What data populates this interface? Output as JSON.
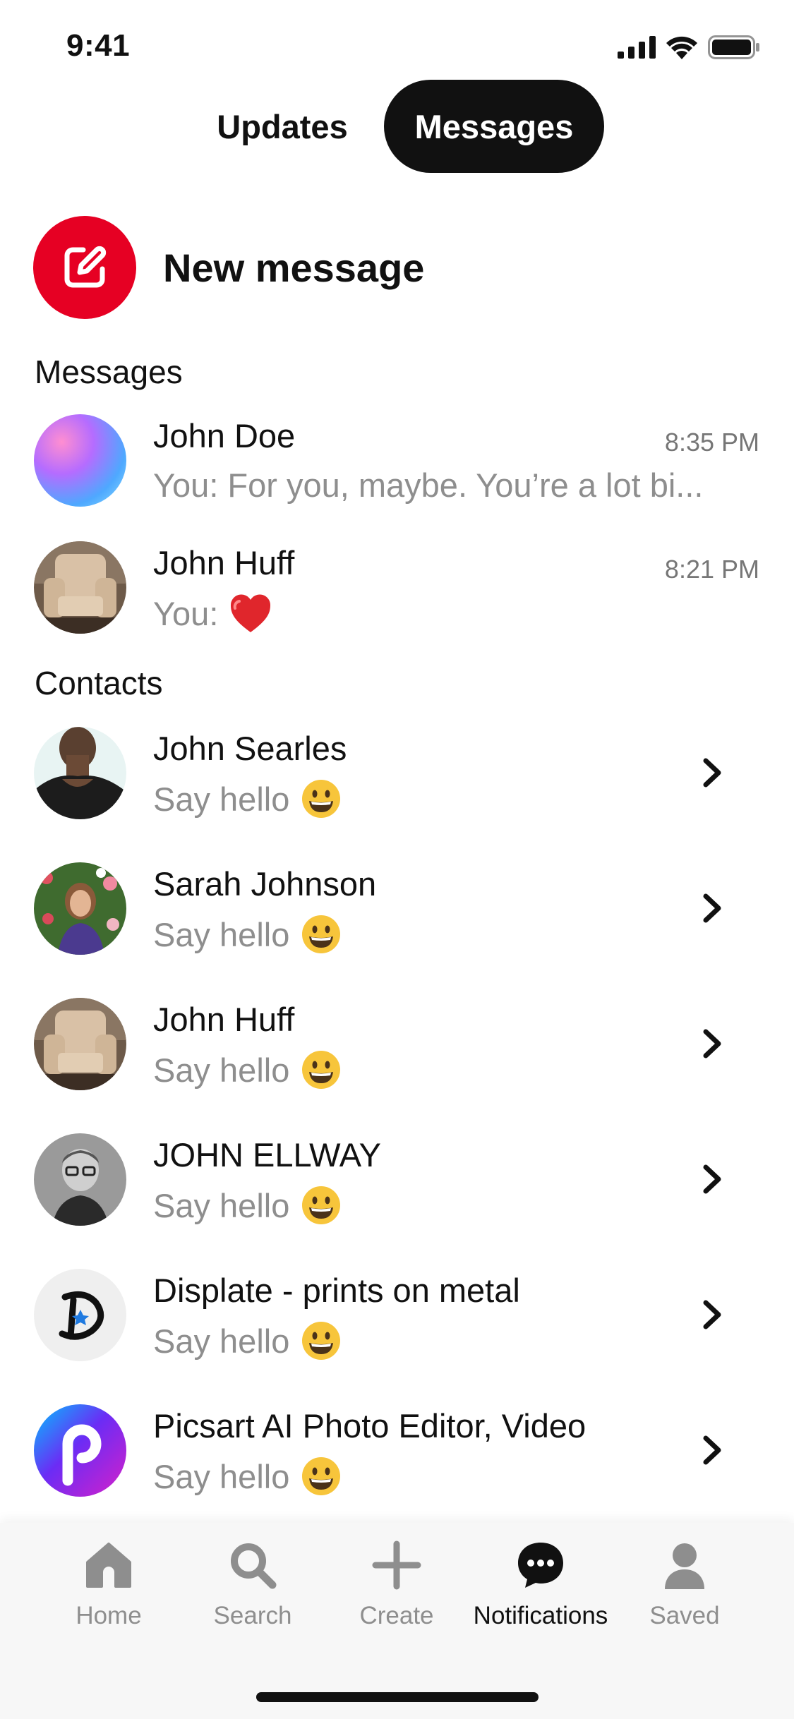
{
  "status_bar": {
    "time": "9:41"
  },
  "tabs": [
    {
      "label": "Updates",
      "active": false
    },
    {
      "label": "Messages",
      "active": true
    }
  ],
  "new_message": {
    "label": "New message",
    "accent": "#e60023"
  },
  "messages_section": {
    "heading": "Messages",
    "items": [
      {
        "name": "John Doe",
        "preview": "You: For you, maybe. You’re a lot bi...",
        "time": "8:35 PM",
        "avatar": "gradient-avatar"
      },
      {
        "name": "John Huff",
        "preview": "You:",
        "preview_emoji": "red-heart",
        "time": "8:21 PM",
        "avatar": "armchair-photo"
      }
    ]
  },
  "contacts_section": {
    "heading": "Contacts",
    "items": [
      {
        "name": "John Searles",
        "sub": "Say hello",
        "avatar": "portrait-photo"
      },
      {
        "name": "Sarah Johnson",
        "sub": "Say hello",
        "avatar": "portrait-photo"
      },
      {
        "name": "John Huff",
        "sub": "Say hello",
        "avatar": "armchair-photo"
      },
      {
        "name": "JOHN ELLWAY",
        "sub": "Say hello",
        "avatar": "portrait-photo"
      },
      {
        "name": "Displate - prints on metal",
        "sub": "Say hello",
        "avatar": "displate-logo"
      },
      {
        "name": "Picsart AI Photo Editor, Video",
        "sub": "Say hello",
        "avatar": "picsart-logo"
      }
    ]
  },
  "bottom_nav": [
    {
      "label": "Home",
      "icon": "home-icon",
      "active": false
    },
    {
      "label": "Search",
      "icon": "search-icon",
      "active": false
    },
    {
      "label": "Create",
      "icon": "plus-icon",
      "active": false
    },
    {
      "label": "Notifications",
      "icon": "chat-bubble-icon",
      "active": true
    },
    {
      "label": "Saved",
      "icon": "profile-icon",
      "active": false
    }
  ]
}
